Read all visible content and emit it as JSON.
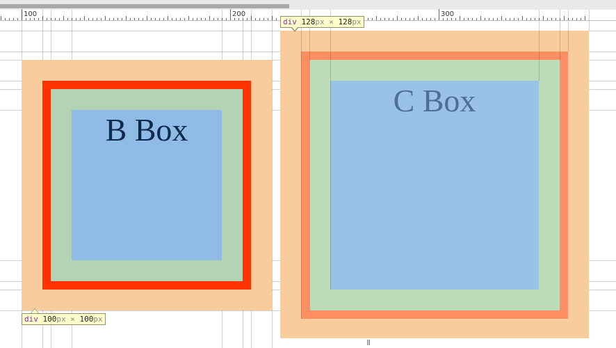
{
  "ruler": {
    "labels": {
      "r100": "100",
      "r200": "200",
      "r300": "300"
    }
  },
  "box_b": {
    "label": "B Box",
    "tooltip": {
      "tag": "div",
      "width": "100",
      "height": "100",
      "unit": "px",
      "times": "×"
    }
  },
  "box_c": {
    "label": "C Box",
    "tooltip": {
      "tag": "div",
      "width": "128",
      "height": "128",
      "unit": "px",
      "times": "×"
    }
  },
  "grip": "|||",
  "colors": {
    "margin": "#f9cc9d",
    "b_border": "#ff3200",
    "c_border": "#ff8f62",
    "padding": "#b2d4b5",
    "content": "#8fbbe6"
  }
}
